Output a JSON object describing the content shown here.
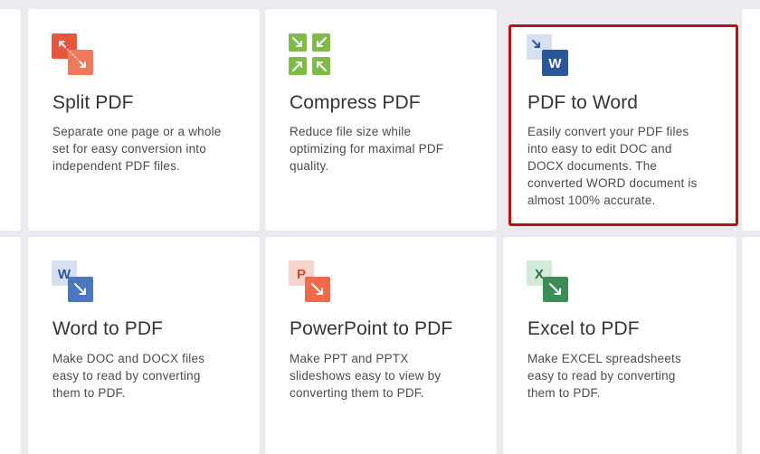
{
  "colors": {
    "highlight_border": "#b3121d",
    "split_icon": "#e5573f",
    "compress_icon": "#7fba4a",
    "word_icon": "#2b579a",
    "powerpoint_icon": "#d24726",
    "excel_icon": "#217346"
  },
  "tools": [
    {
      "name": "split-pdf",
      "icon": "split-icon",
      "title": "Split PDF",
      "description_lines": [
        "Separate one page or a whole",
        "set for easy conversion into",
        "independent PDF files."
      ]
    },
    {
      "name": "compress-pdf",
      "icon": "compress-icon",
      "title": "Compress PDF",
      "description_lines": [
        "Reduce file size while",
        "optimizing for maximal PDF",
        "quality."
      ]
    },
    {
      "name": "pdf-to-word",
      "icon": "pdf-to-word-icon",
      "icon_letter": "W",
      "title": "PDF to Word",
      "highlighted": true,
      "description_lines": [
        "Easily convert your PDF files",
        "into easy to edit DOC and",
        "DOCX documents. The",
        "converted WORD document is",
        "almost 100% accurate."
      ]
    },
    {
      "name": "word-to-pdf",
      "icon": "word-to-pdf-icon",
      "icon_letter": "W",
      "title": "Word to PDF",
      "description_lines": [
        "Make DOC and DOCX files",
        "easy to read by converting",
        "them to PDF."
      ]
    },
    {
      "name": "powerpoint-to-pdf",
      "icon": "powerpoint-to-pdf-icon",
      "icon_letter": "P",
      "title": "PowerPoint to PDF",
      "description_lines": [
        "Make PPT and PPTX",
        "slideshows easy to view by",
        "converting them to PDF."
      ]
    },
    {
      "name": "excel-to-pdf",
      "icon": "excel-to-pdf-icon",
      "icon_letter": "X",
      "title": "Excel to PDF",
      "description_lines": [
        "Make EXCEL spreadsheets",
        "easy to read by converting",
        "them to PDF."
      ]
    }
  ]
}
